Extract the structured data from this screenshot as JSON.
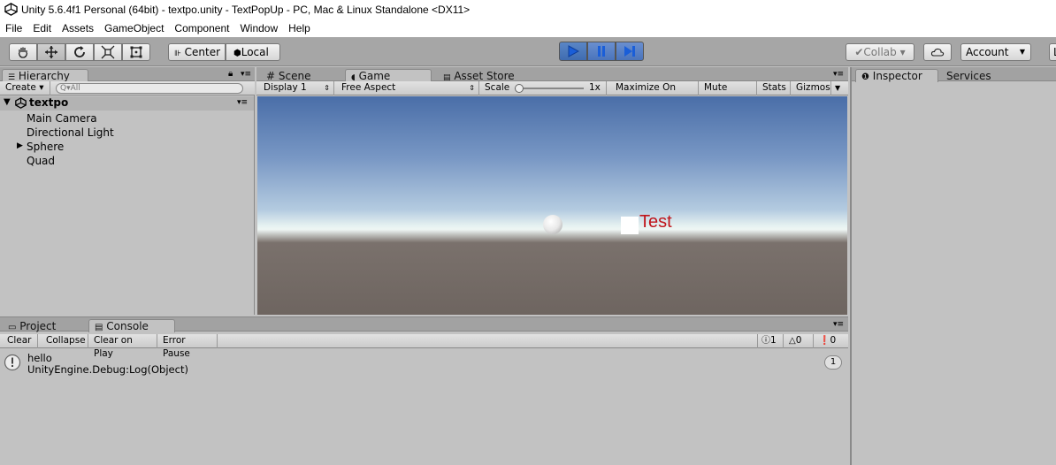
{
  "window": {
    "title": "Unity 5.6.4f1 Personal (64bit) - textpo.unity - TextPopUp - PC, Mac & Linux Standalone <DX11>"
  },
  "menu": [
    "File",
    "Edit",
    "Assets",
    "GameObject",
    "Component",
    "Window",
    "Help"
  ],
  "toolbar": {
    "center_label": "Center",
    "local_label": "Local",
    "collab_label": "Collab ▾",
    "account_label": "Account",
    "layers_label": "L"
  },
  "hierarchy": {
    "tab_label": "Hierarchy",
    "create_label": "Create ▾",
    "search_placeholder": "Q▾All",
    "scene_name": "textpo",
    "items": [
      "Main Camera",
      "Directional Light",
      "Sphere",
      "Quad"
    ]
  },
  "center_tabs": {
    "scene": "Scene",
    "game": "Game",
    "asset_store": "Asset Store"
  },
  "game_bar": {
    "display": "Display 1",
    "aspect": "Free Aspect",
    "scale_label": "Scale",
    "scale_value": "1x",
    "maximize": "Maximize On Play",
    "mute": "Mute Audio",
    "stats": "Stats",
    "gizmos": "Gizmos"
  },
  "game_view": {
    "overlay_text": "Test",
    "text_color": "#c0141a"
  },
  "bottom_tabs": {
    "project": "Project",
    "console": "Console"
  },
  "console_bar": {
    "clear": "Clear",
    "collapse": "Collapse",
    "clear_on_play": "Clear on Play",
    "error_pause": "Error Pause",
    "info_count": "1",
    "warn_count": "0",
    "error_count": "0"
  },
  "console_log": {
    "line1": "hello",
    "line2": "UnityEngine.Debug:Log(Object)",
    "count": "1"
  },
  "right_tabs": {
    "inspector": "Inspector",
    "services": "Services"
  }
}
